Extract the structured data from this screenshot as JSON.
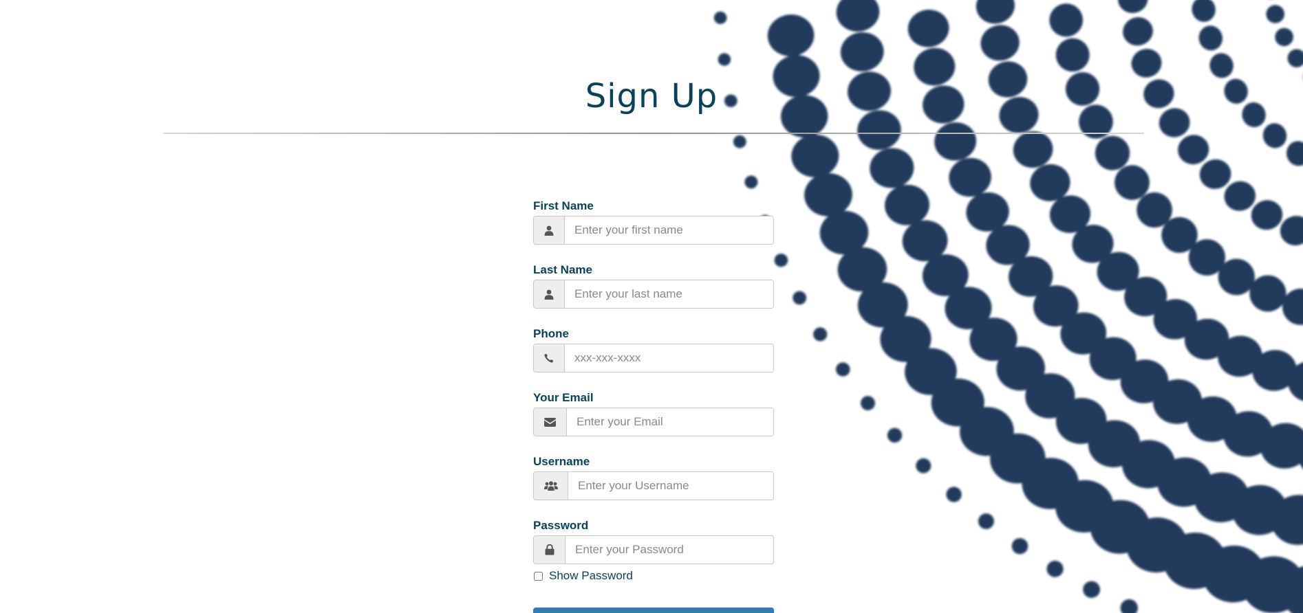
{
  "page": {
    "title": "Sign Up"
  },
  "colors": {
    "title_text": "#0b4257",
    "label_text": "#0b4257",
    "dot": "#233a5c",
    "submit_button": "#337ab7"
  },
  "form": {
    "fields": [
      {
        "label": "First Name",
        "placeholder": "Enter your first name",
        "icon": "user-icon",
        "type": "text"
      },
      {
        "label": "Last Name",
        "placeholder": "Enter your last name",
        "icon": "user-icon",
        "type": "text"
      },
      {
        "label": "Phone",
        "placeholder": "xxx-xxx-xxxx",
        "icon": "phone-icon",
        "type": "tel"
      },
      {
        "label": "Your Email",
        "placeholder": "Enter your Email",
        "icon": "envelope-icon",
        "type": "email"
      },
      {
        "label": "Username",
        "placeholder": "Enter your Username",
        "icon": "users-icon",
        "type": "text"
      },
      {
        "label": "Password",
        "placeholder": "Enter your Password",
        "icon": "lock-icon",
        "type": "password"
      }
    ],
    "show_password_label": "Show Password",
    "show_password_checked": false
  }
}
